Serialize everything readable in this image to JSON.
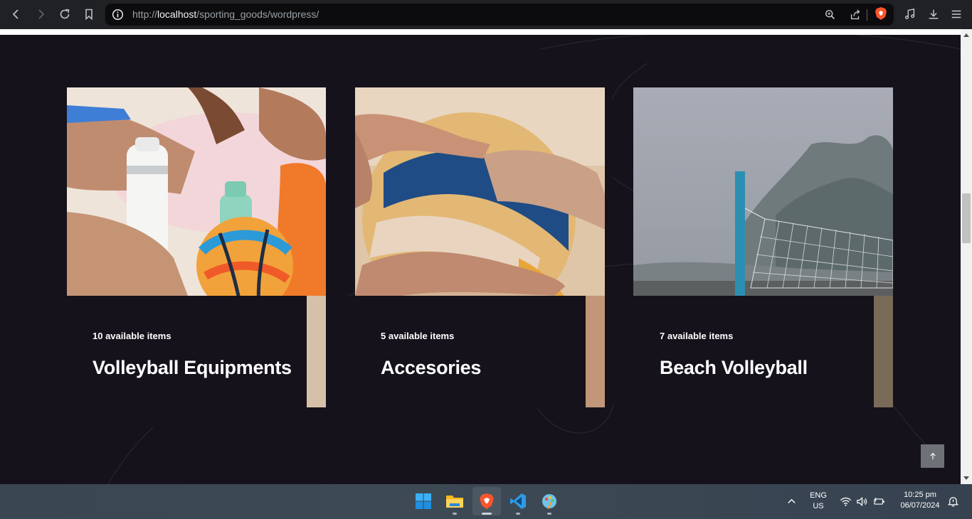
{
  "browser": {
    "url_prefix": "http://",
    "url_host": "localhost",
    "url_path": "/sporting_goods/wordpress/",
    "icons": [
      "back-icon",
      "forward-icon",
      "reload-icon",
      "bookmark-icon",
      "site-info-icon",
      "zoom-icon",
      "share-icon",
      "brave-shields-icon",
      "media-icon",
      "download-icon",
      "menu-icon"
    ]
  },
  "categories": [
    {
      "count_label": "10 available items",
      "title": "Volleyball Equipments"
    },
    {
      "count_label": "5 available items",
      "title": "Accesories"
    },
    {
      "count_label": "7 available items",
      "title": "Beach Volleyball"
    }
  ],
  "back_to_top": {
    "icon": "arrow-up-icon"
  },
  "taskbar": {
    "apps": [
      "windows-start-icon",
      "file-explorer-icon",
      "brave-browser-icon",
      "vscode-icon",
      "paint-icon"
    ],
    "language_line1": "ENG",
    "language_line2": "US",
    "time": "10:25 pm",
    "date": "06/07/2024"
  },
  "colors": {
    "page_background": "#15121b",
    "browser_chrome": "#202124",
    "text": "#ffffff"
  }
}
